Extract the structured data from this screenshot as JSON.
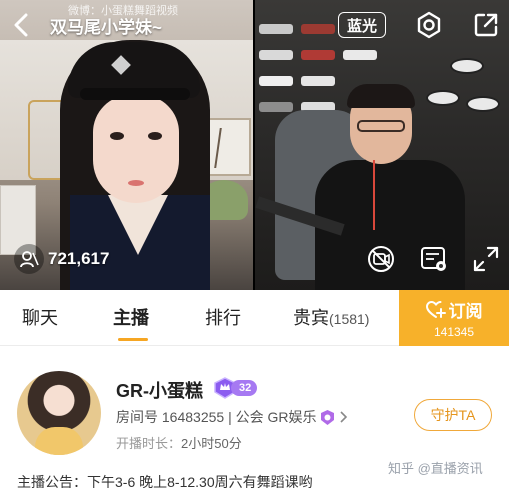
{
  "header": {
    "title": "双马尾小学妹~",
    "quality_label": "蓝光"
  },
  "video": {
    "left_watermark": "微博：小蛋糕舞蹈视频",
    "viewer_count": "721,617"
  },
  "tabs": [
    {
      "label": "聊天"
    },
    {
      "label": "主播",
      "active": true
    },
    {
      "label": "排行"
    },
    {
      "label": "贵宾",
      "count": "(1581)"
    }
  ],
  "subscribe": {
    "label": "订阅",
    "count": "141345"
  },
  "streamer": {
    "name": "GR-小蛋糕",
    "level": "32",
    "room_line": "房间号 16483255 | 公会 GR娱乐",
    "duration_label": "开播时长：",
    "duration_value": "2小时50分",
    "guard_label": "守护TA",
    "announcement": "主播公告：下午3-6  晚上8-12.30周六有舞蹈课哟"
  },
  "watermark": "知乎 @直播资讯",
  "colors": {
    "accent": "#f7b12a",
    "level_badge": "#a679f2",
    "guard_border": "#f0a83a"
  },
  "icons": [
    "back-arrow-icon",
    "settings-icon",
    "share-icon",
    "viewers-icon",
    "camera-off-icon",
    "danmaku-settings-icon",
    "fullscreen-icon",
    "heart-plus-icon",
    "crown-level-icon",
    "guild-icon",
    "chevron-right-icon"
  ]
}
